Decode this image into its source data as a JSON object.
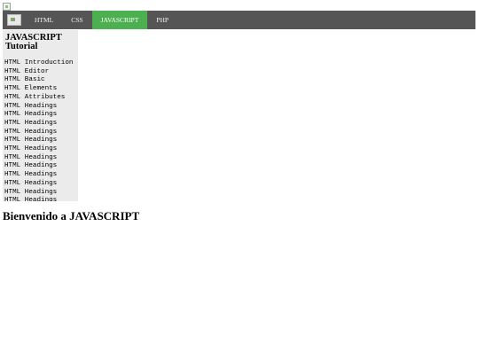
{
  "nav": {
    "items": [
      {
        "label": "HTML",
        "active": false
      },
      {
        "label": "CSS",
        "active": false
      },
      {
        "label": "JAVASCRIPT",
        "active": true
      },
      {
        "label": "PHP",
        "active": false
      }
    ],
    "background_color": "#555555",
    "active_color": "#4caf50"
  },
  "sidebar": {
    "title": "JAVASCRIPT Tutorial",
    "background_color": "#ebebeb",
    "items": [
      "HTML Introduction",
      "HTML Editor",
      "HTML Basic",
      "HTML Elements",
      "HTML Attributes",
      "HTML Headings",
      "HTML Headings",
      "HTML Headings",
      "HTML Headings",
      "HTML Headings",
      "HTML Headings",
      "HTML Headings",
      "HTML Headings",
      "HTML Headings",
      "HTML Headings",
      "HTML Headings",
      "HTML Headings"
    ]
  },
  "main": {
    "heading": "Bienvenido a JAVASCRIPT"
  }
}
